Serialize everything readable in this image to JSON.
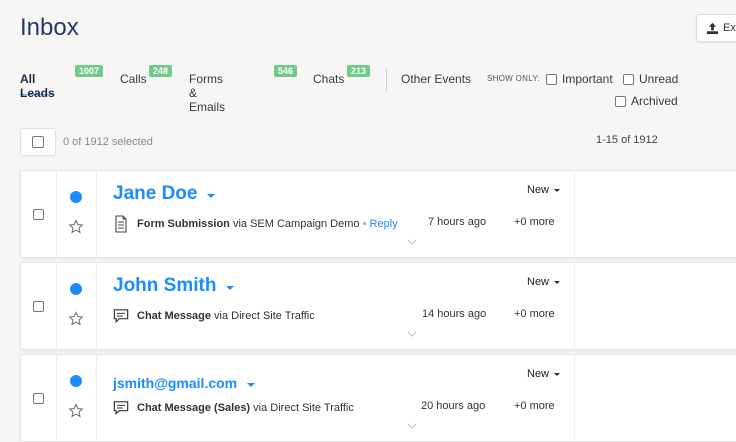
{
  "header": {
    "title": "Inbox",
    "export_label": "Ex"
  },
  "tabs": [
    {
      "label": "All Leads",
      "count": "1007"
    },
    {
      "label": "Calls",
      "count": "248"
    },
    {
      "label": "Forms & Emails",
      "count": "546"
    },
    {
      "label": "Chats",
      "count": "213"
    }
  ],
  "filters": {
    "other_events": "Other Events",
    "show_only": "SHOW ONLY:",
    "options": [
      {
        "label": "Important"
      },
      {
        "label": "Unread"
      },
      {
        "label": "Archived"
      }
    ]
  },
  "selection": {
    "text": "0 of 1912 selected"
  },
  "pagination": {
    "text": "1-15 of 1912"
  },
  "leads": [
    {
      "name": "Jane Doe",
      "status": "New",
      "activity_type": "Form Submission",
      "activity_source": "via SEM Campaign Demo",
      "reply_label": "Reply",
      "time": "7 hours ago",
      "more": "+0 more",
      "icon": "form-icon"
    },
    {
      "name": "John Smith",
      "status": "New",
      "activity_type": "Chat Message",
      "activity_source": "via Direct Site Traffic",
      "time": "14 hours ago",
      "more": "+0 more",
      "icon": "chat-icon"
    },
    {
      "name": "jsmith@gmail.com",
      "status": "New",
      "activity_type": "Chat Message (Sales)",
      "activity_source": "via Direct Site Traffic",
      "time": "20 hours ago",
      "more": "+0 more",
      "icon": "chat-icon"
    }
  ],
  "colors": {
    "accent": "#1a8cff",
    "badge": "#6fcb8b",
    "title": "#243a6b"
  }
}
